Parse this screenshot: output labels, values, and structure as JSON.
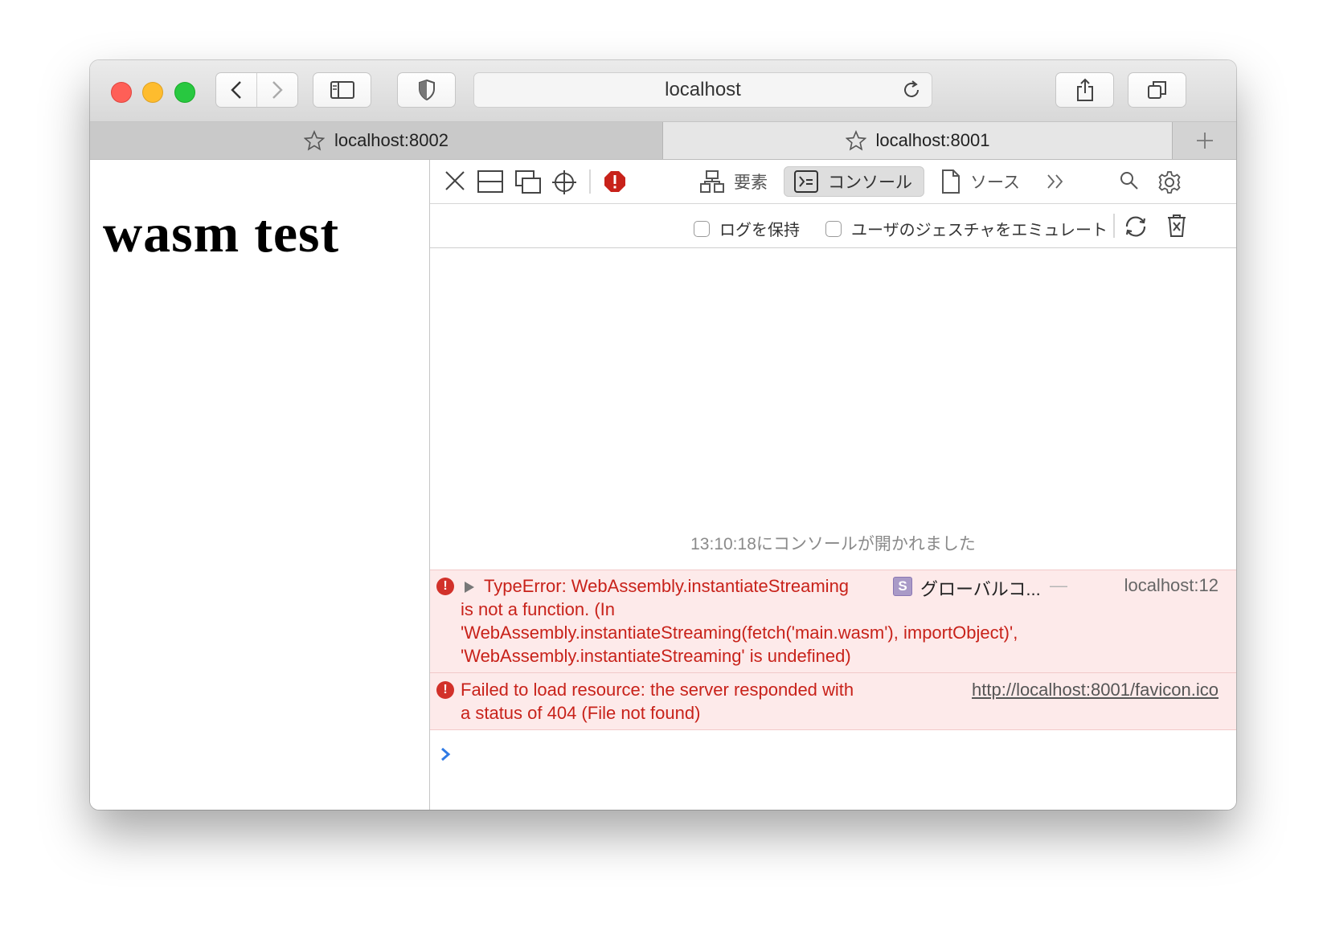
{
  "window": {
    "url_display": "localhost",
    "tabs": [
      {
        "label": "localhost:8002",
        "active": true
      },
      {
        "label": "localhost:8001",
        "active": false
      }
    ]
  },
  "page": {
    "heading": "wasm test"
  },
  "devtools": {
    "tabs": {
      "elements": "要素",
      "console": "コンソール",
      "sources": "ソース"
    },
    "filters": {
      "preserve_log": "ログを保持",
      "emulate_gesture": "ユーザのジェスチャをエミュレート"
    },
    "console": {
      "opened_text": "13:10:18にコンソールが開かれました",
      "messages": [
        {
          "level": "error",
          "lines": [
            "TypeError: WebAssembly.instantiateStreaming",
            "is not a function. (In",
            "'WebAssembly.instantiateStreaming(fetch('main.wasm'), importObject)',",
            "'WebAssembly.instantiateStreaming' is undefined)"
          ],
          "badge": "S",
          "function": "グローバルコ...",
          "separator": "—",
          "location": "localhost:12"
        },
        {
          "level": "error",
          "lines": [
            "Failed to load resource: the server responded with",
            "a status of 404 (File not found)"
          ],
          "url": "http://localhost:8001/favicon.ico"
        }
      ]
    }
  },
  "colors": {
    "error_text": "#c8221a",
    "error_bg": "#fdeaea",
    "prompt": "#2f7ae5"
  }
}
